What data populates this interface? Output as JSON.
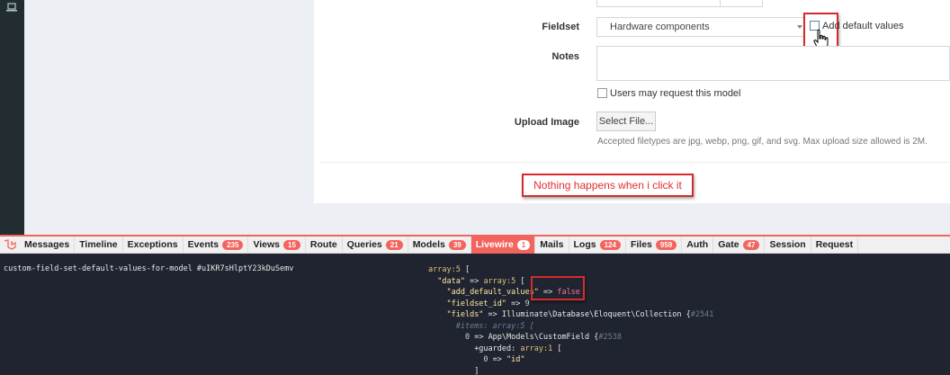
{
  "form": {
    "fieldset_label": "Fieldset",
    "fieldset_value": "Hardware components",
    "add_default_values_label": "Add default values",
    "notes_label": "Notes",
    "notes_value": "",
    "request_label": "Users may request this model",
    "upload_label": "Upload Image",
    "select_file_label": "Select File...",
    "upload_help": "Accepted filetypes are jpg, webp, png, gif, and svg. Max upload size allowed is 2M."
  },
  "annotation": {
    "text": "Nothing happens when i click it",
    "color": "#d62b2b"
  },
  "debugbar": {
    "accent": "#f4645f",
    "tabs": [
      {
        "label": "Messages",
        "badge": ""
      },
      {
        "label": "Timeline",
        "badge": ""
      },
      {
        "label": "Exceptions",
        "badge": ""
      },
      {
        "label": "Events",
        "badge": "235"
      },
      {
        "label": "Views",
        "badge": "15"
      },
      {
        "label": "Route",
        "badge": ""
      },
      {
        "label": "Queries",
        "badge": "21"
      },
      {
        "label": "Models",
        "badge": "39"
      },
      {
        "label": "Livewire",
        "badge": "1"
      },
      {
        "label": "Mails",
        "badge": ""
      },
      {
        "label": "Logs",
        "badge": "124"
      },
      {
        "label": "Files",
        "badge": "959"
      },
      {
        "label": "Auth",
        "badge": ""
      },
      {
        "label": "Gate",
        "badge": "47"
      },
      {
        "label": "Session",
        "badge": ""
      },
      {
        "label": "Request",
        "badge": ""
      }
    ],
    "active_tab": "Livewire",
    "component_name": "custom-field-set-default-values-for-model #uIKR7sHlptY23kDuSemv",
    "dump": {
      "l1_type": "array:5",
      "l2_key": "\"data\"",
      "l2_type": "array:5",
      "l3_key": "\"add_default_values\"",
      "l3_val": "false",
      "l4_key": "\"fieldset_id\"",
      "l4_val": "9",
      "l5_key": "\"fields\"",
      "l5_class": "Illuminate\\Database\\Eloquent\\Collection",
      "l5_ref": "#2541",
      "l6_items": "#items: array:5 [",
      "l7_key": "0",
      "l7_class": "App\\Models\\CustomField",
      "l7_ref": "#2538",
      "l8_key": "+guarded:",
      "l8_type": "array:1",
      "l9_key": "0",
      "l9_val": "\"id\"",
      "l10": "]"
    }
  }
}
